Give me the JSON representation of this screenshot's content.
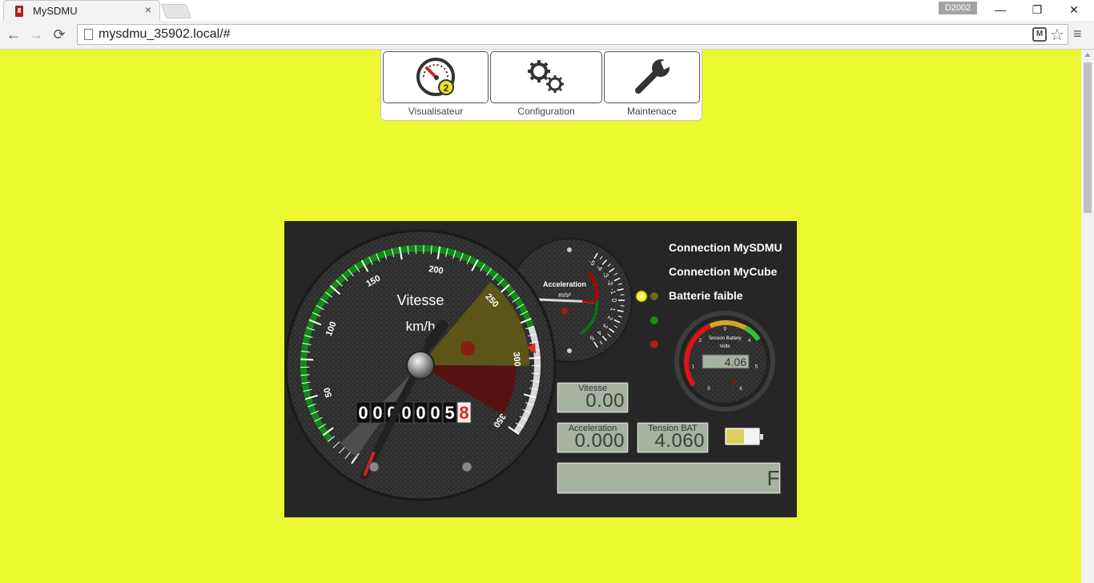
{
  "browser": {
    "tab_title": "MySDMU",
    "tab_close": "×",
    "profile_badge": "D2002",
    "url": "mysdmu_35902.local/#",
    "back_glyph": "←",
    "forward_glyph": "→",
    "reload_glyph": "⟳",
    "minimize_glyph": "—",
    "restore_glyph": "❐",
    "close_glyph": "✕",
    "menu_glyph": "≡",
    "star_glyph": "☆",
    "ext_glyph": "M"
  },
  "menu": {
    "items": [
      {
        "label": "Visualisateur",
        "icon": "speedometer-icon"
      },
      {
        "label": "Configuration",
        "icon": "gears-icon"
      },
      {
        "label": "Maintenace",
        "icon": "wrench-icon"
      }
    ]
  },
  "speedometer": {
    "title": "Vitesse",
    "unit": "km/h",
    "ticks": [
      "50",
      "100",
      "150",
      "200",
      "250",
      "300",
      "350"
    ],
    "odometer": [
      "0",
      "0",
      "0",
      "0",
      "0",
      "0",
      "5",
      "8"
    ],
    "needle_value": 0
  },
  "acceleration_gauge": {
    "title": "Acceleration",
    "unit": "m/s²",
    "ticks": [
      "-5",
      "-4",
      "-3",
      "-2",
      "-1",
      "0",
      "1",
      "2",
      "3",
      "4",
      "5"
    ],
    "needle_value": 0
  },
  "battery_gauge": {
    "title": "Tension Battery",
    "unit": "Volts",
    "value": "4.06",
    "ticks": [
      "0",
      "1",
      "2",
      "3",
      "4",
      "5",
      "6"
    ]
  },
  "leds": [
    {
      "label": "Connection MySDMU",
      "color": "#ffff00"
    },
    {
      "label": "Connection MyCube",
      "color": "#1f8a12"
    },
    {
      "label": "Batterie faible",
      "color": "#b01e0c"
    }
  ],
  "displays": {
    "vitesse": {
      "label": "Vitesse",
      "value": "0.00"
    },
    "acceleration": {
      "label": "Acceleration",
      "value": "0.000"
    },
    "tension_bat": {
      "label": "Tension BAT",
      "value": "4.060"
    },
    "message": {
      "value": "F"
    }
  },
  "battery_level": 0.55,
  "colors": {
    "page_background": "#ebf72f",
    "dashboard_background": "#262626",
    "lcd_background": "#a6b2a2"
  }
}
